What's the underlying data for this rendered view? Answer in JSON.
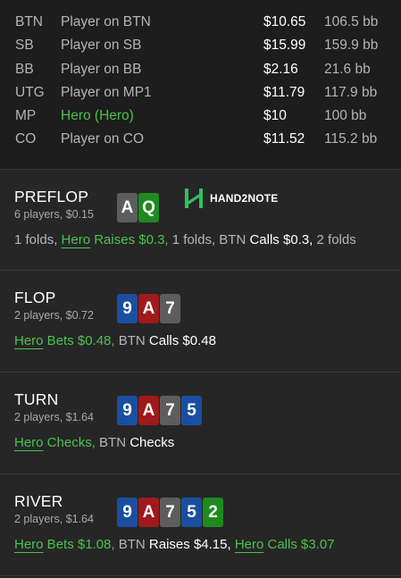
{
  "players": [
    {
      "pos": "BTN",
      "name": "Player on BTN",
      "stack": "$10.65",
      "bb": "106.5 bb",
      "hero": false
    },
    {
      "pos": "SB",
      "name": "Player on SB",
      "stack": "$15.99",
      "bb": "159.9 bb",
      "hero": false
    },
    {
      "pos": "BB",
      "name": "Player on BB",
      "stack": "$2.16",
      "bb": "21.6 bb",
      "hero": false
    },
    {
      "pos": "UTG",
      "name": "Player on MP1",
      "stack": "$11.79",
      "bb": "117.9 bb",
      "hero": false
    },
    {
      "pos": "MP",
      "name": "Hero (Hero)",
      "stack": "$10",
      "bb": "100 bb",
      "hero": true
    },
    {
      "pos": "CO",
      "name": "Player on CO",
      "stack": "$11.52",
      "bb": "115.2 bb",
      "hero": false
    }
  ],
  "colors": {
    "spade_club_gray": "#5d5d5d",
    "diamond_blue": "#1a4fa0",
    "heart_red": "#a0191b",
    "club_green": "#1f8a1f",
    "hero_green": "#4bc24e"
  },
  "logo": {
    "text": "HAND2NOTE",
    "icon": "h2n-logo-icon"
  },
  "streets": [
    {
      "name": "PREFLOP",
      "sub": "6 players, $0.15",
      "cards": [
        {
          "rank": "A",
          "color": "#5d5d5d"
        },
        {
          "rank": "Q",
          "color": "#1f8a1f"
        }
      ],
      "actions": [
        {
          "t": "1 folds, ",
          "c": "plain"
        },
        {
          "t": "Hero",
          "c": "hero"
        },
        {
          "t": " Raises $0.3,",
          "c": "green"
        },
        {
          "t": " 1 folds, BTN ",
          "c": "plain"
        },
        {
          "t": "Calls $0.3,",
          "c": "white"
        },
        {
          "t": " 2 folds",
          "c": "plain"
        }
      ]
    },
    {
      "name": "FLOP",
      "sub": "2 players, $0.72",
      "cards": [
        {
          "rank": "9",
          "color": "#1a4fa0"
        },
        {
          "rank": "A",
          "color": "#a0191b"
        },
        {
          "rank": "7",
          "color": "#5d5d5d"
        }
      ],
      "actions": [
        {
          "t": "Hero",
          "c": "hero"
        },
        {
          "t": " Bets $0.48,",
          "c": "green"
        },
        {
          "t": " BTN ",
          "c": "plain"
        },
        {
          "t": "Calls $0.48",
          "c": "white"
        }
      ]
    },
    {
      "name": "TURN",
      "sub": "2 players, $1.64",
      "cards": [
        {
          "rank": "9",
          "color": "#1a4fa0"
        },
        {
          "rank": "A",
          "color": "#a0191b"
        },
        {
          "rank": "7",
          "color": "#5d5d5d"
        },
        {
          "rank": "5",
          "color": "#1a4fa0"
        }
      ],
      "actions": [
        {
          "t": "Hero",
          "c": "hero"
        },
        {
          "t": " Checks,",
          "c": "green"
        },
        {
          "t": " BTN ",
          "c": "plain"
        },
        {
          "t": "Checks",
          "c": "white"
        }
      ]
    },
    {
      "name": "RIVER",
      "sub": "2 players, $1.64",
      "cards": [
        {
          "rank": "9",
          "color": "#1a4fa0"
        },
        {
          "rank": "A",
          "color": "#a0191b"
        },
        {
          "rank": "7",
          "color": "#5d5d5d"
        },
        {
          "rank": "5",
          "color": "#1a4fa0"
        },
        {
          "rank": "2",
          "color": "#1f8a1f"
        }
      ],
      "actions": [
        {
          "t": "Hero",
          "c": "hero"
        },
        {
          "t": " Bets $1.08,",
          "c": "green"
        },
        {
          "t": " BTN ",
          "c": "plain"
        },
        {
          "t": "Raises $4.15,",
          "c": "white"
        },
        {
          "t": " ",
          "c": "plain"
        },
        {
          "t": "Hero",
          "c": "hero"
        },
        {
          "t": " Calls $3.07",
          "c": "green"
        }
      ]
    }
  ]
}
